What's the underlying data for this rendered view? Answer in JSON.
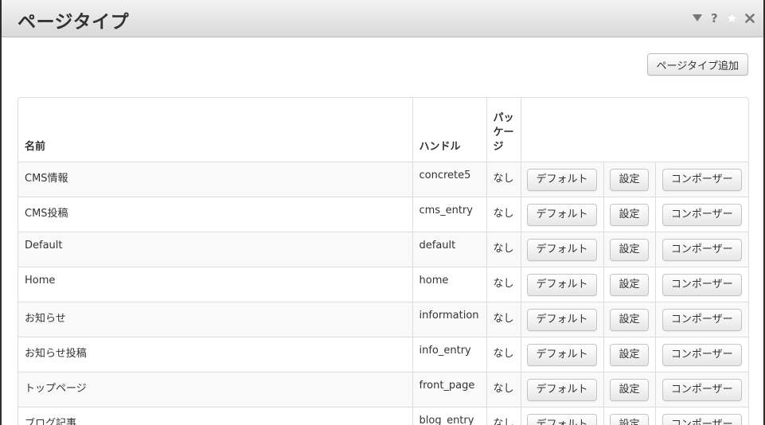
{
  "dialog": {
    "title": "ページタイプ",
    "add_button_label": "ページタイプ追加"
  },
  "table": {
    "headers": {
      "name": "名前",
      "handle": "ハンドル",
      "package_lines": [
        "パッ",
        "ケー",
        "ジ"
      ]
    },
    "button_labels": {
      "defaults": "デフォルト",
      "settings": "設定",
      "composer": "コンポーザー"
    },
    "rows": [
      {
        "name": "CMS情報",
        "handle": "concrete5",
        "package": "なし"
      },
      {
        "name": "CMS投稿",
        "handle": "cms_entry",
        "package": "なし"
      },
      {
        "name": "Default",
        "handle": "default",
        "package": "なし"
      },
      {
        "name": "Home",
        "handle": "home",
        "package": "なし"
      },
      {
        "name": "お知らせ",
        "handle": "information",
        "package": "なし"
      },
      {
        "name": "お知らせ投稿",
        "handle": "info_entry",
        "package": "なし"
      },
      {
        "name": "トップページ",
        "handle": "front_page",
        "package": "なし"
      },
      {
        "name": "ブログ記事",
        "handle": "blog_entry",
        "package": "なし"
      }
    ]
  },
  "icons": [
    "dropdown-triangle-icon",
    "help-icon",
    "star-icon",
    "close-icon"
  ]
}
